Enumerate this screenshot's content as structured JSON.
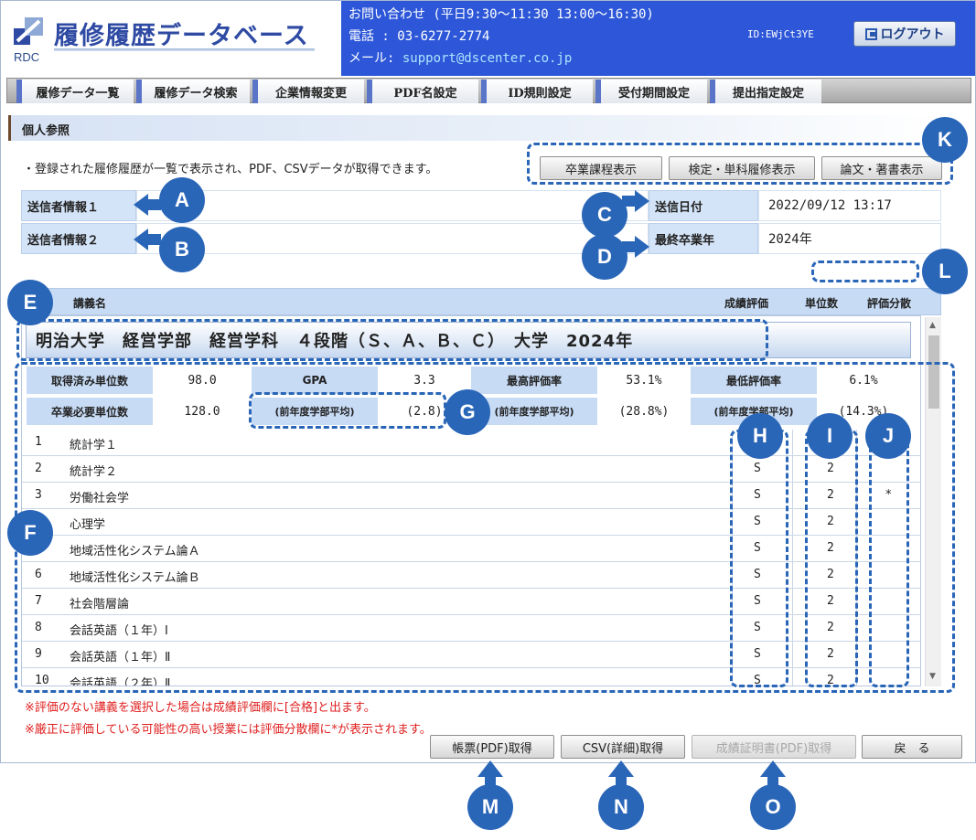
{
  "header": {
    "title": "履修履歴データベース",
    "logo_sub": "RDC",
    "contact_hours": "お問い合わせ (平日9:30～11:30 13:00～16:30)",
    "phone": "電話  : 03-6277-2774",
    "mail_label": "メール: ",
    "mail": "support@dscenter.co.jp",
    "user_id": "ID:EWjCt3YE",
    "logout_label": "ログアウト"
  },
  "nav": {
    "items": [
      "履修データ一覧",
      "履修データ検索",
      "企業情報変更",
      "PDF名設定",
      "ID規則設定",
      "受付期間設定",
      "提出指定設定"
    ]
  },
  "page": {
    "section_title": "個人参照",
    "description": "・登録された履修履歴が一覧で表示され、PDF、CSVデータが取得できます。",
    "view_buttons": [
      "卒業課程表示",
      "検定・単科履修表示",
      "論文・著書表示"
    ]
  },
  "info": {
    "sender1_label": "送信者情報１",
    "sender2_label": "送信者情報２",
    "sent_date_label": "送信日付",
    "sent_date": "2022/09/12 13:17",
    "grad_year_label": "最終卒業年",
    "grad_year": "2024年"
  },
  "table": {
    "headers": {
      "course": "講義名",
      "grade": "成績評価",
      "credit": "単位数",
      "dist": "評価分散"
    },
    "university": "明治大学　経営学部　経営学科　４段階（Ｓ、Ａ、Ｂ、Ｃ）　大学　2024年",
    "summary": {
      "earned_label": "取得済み単位数",
      "earned": "98.0",
      "gpa_label": "GPA",
      "gpa": "3.3",
      "max_label": "最高評価率",
      "max": "53.1%",
      "min_label": "最低評価率",
      "min": "6.1%",
      "required_label": "卒業必要単位数",
      "required": "128.0",
      "prev_avg_label": "(前年度学部平均)",
      "prev_gpa": "(2.8)",
      "prev_avg_label2": "(前年度学部平均)",
      "prev_max": "(28.8%)",
      "prev_avg_label3": "(前年度学部平均)",
      "prev_min": "(14.3%)"
    },
    "rows": [
      {
        "no": "1",
        "name": "統計学１",
        "grade": "",
        "credit": "",
        "dist": ""
      },
      {
        "no": "2",
        "name": "統計学２",
        "grade": "S",
        "credit": "2",
        "dist": ""
      },
      {
        "no": "3",
        "name": "労働社会学",
        "grade": "S",
        "credit": "2",
        "dist": "*"
      },
      {
        "no": "4",
        "name": "心理学",
        "grade": "S",
        "credit": "2",
        "dist": ""
      },
      {
        "no": "5",
        "name": "地域活性化システム論Ａ",
        "grade": "S",
        "credit": "2",
        "dist": ""
      },
      {
        "no": "6",
        "name": "地域活性化システム論Ｂ",
        "grade": "S",
        "credit": "2",
        "dist": ""
      },
      {
        "no": "7",
        "name": "社会階層論",
        "grade": "S",
        "credit": "2",
        "dist": ""
      },
      {
        "no": "8",
        "name": "会話英語（１年）Ⅰ",
        "grade": "S",
        "credit": "2",
        "dist": ""
      },
      {
        "no": "9",
        "name": "会話英語（１年）Ⅱ",
        "grade": "S",
        "credit": "2",
        "dist": ""
      },
      {
        "no": "10",
        "name": "会話英語（２年）Ⅱ",
        "grade": "S",
        "credit": "2",
        "dist": ""
      }
    ]
  },
  "notes": {
    "note1": "※評価のない講義を選択した場合は成績評価欄に[合格]と出ます。",
    "note2": "※厳正に評価している可能性の高い授業には評価分散欄に*が表示されます。"
  },
  "footer": {
    "pdf_label": "帳票(PDF)取得",
    "csv_label": "CSV(詳細)取得",
    "cert_label": "成績証明書(PDF)取得",
    "back_label": "戻　る"
  },
  "annotations": {
    "A": "A",
    "B": "B",
    "C": "C",
    "D": "D",
    "E": "E",
    "F": "F",
    "G": "G",
    "H": "H",
    "I": "I",
    "J": "J",
    "K": "K",
    "L": "L",
    "M": "M",
    "N": "N",
    "O": "O"
  }
}
